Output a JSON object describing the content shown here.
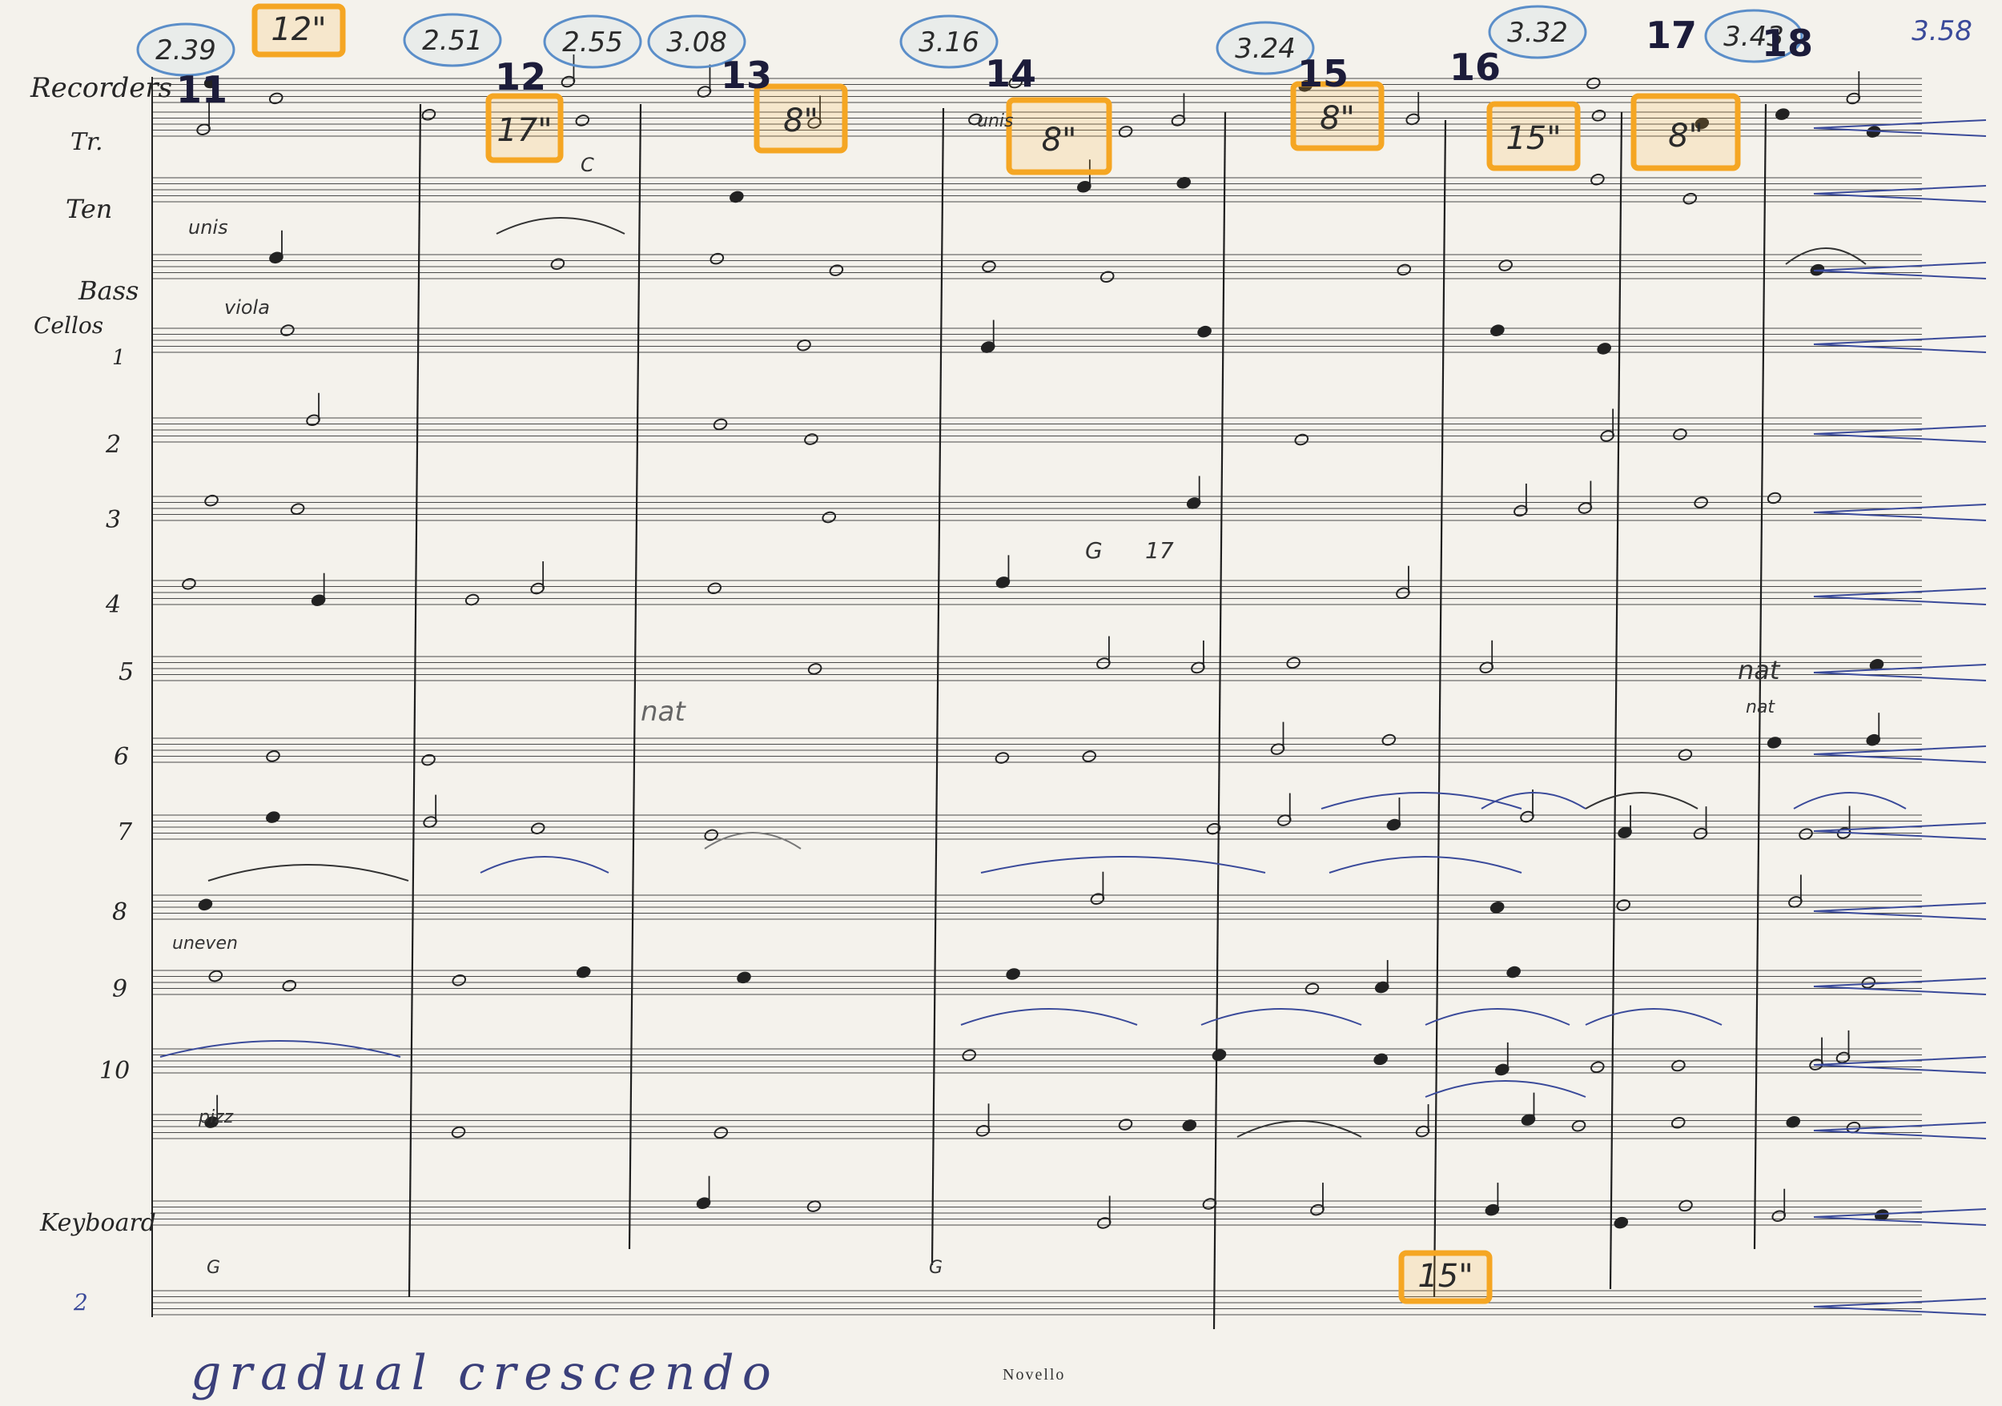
{
  "document": {
    "publisher_mark": "Novello",
    "bottom_instruction": "gradual crescendo",
    "instrument_labels": [
      {
        "text": "Recorders"
      },
      {
        "text": "Tr."
      },
      {
        "text": "Ten"
      },
      {
        "text": "Bass"
      },
      {
        "text": "Cellos"
      },
      {
        "text": "1"
      },
      {
        "text": "2"
      },
      {
        "text": "3"
      },
      {
        "text": "4"
      },
      {
        "text": "5"
      },
      {
        "text": "6"
      },
      {
        "text": "7"
      },
      {
        "text": "8"
      },
      {
        "text": "9"
      },
      {
        "text": "10"
      },
      {
        "text": "Keyboard"
      },
      {
        "text": "2"
      }
    ],
    "rehearsal_marks": [
      "11",
      "12",
      "13",
      "14",
      "15",
      "16",
      "17",
      "18"
    ],
    "timings": [
      "2.39",
      "2.51",
      "2.55",
      "3.08",
      "3.16",
      "3.24",
      "3.32",
      "3.43",
      "3.58"
    ],
    "durations": [
      "12\"",
      "17\"",
      "8\"",
      "8\"",
      "8\"",
      "15\"",
      "8\"",
      "15\""
    ],
    "annotations": [
      "unis",
      "viola",
      "nat",
      "nat",
      "nat",
      "uneven",
      "pizz",
      "G",
      "17",
      "C",
      "G",
      "G",
      "unis"
    ]
  }
}
